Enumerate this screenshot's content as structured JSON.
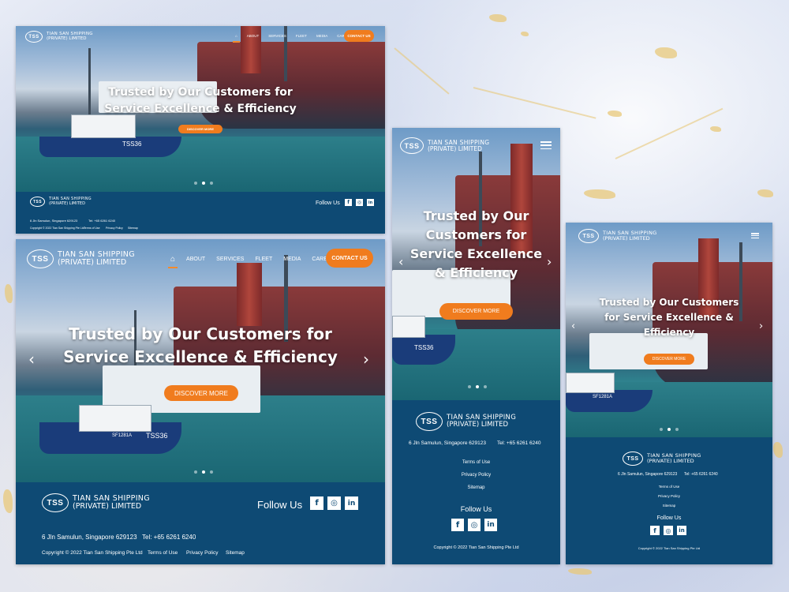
{
  "brand": {
    "initials": "TSS",
    "name_line1": "TIAN SAN SHIPPING",
    "name_line2": "(PRIVATE) LIMITED"
  },
  "nav": {
    "items": [
      "ABOUT",
      "SERVICES",
      "FLEET",
      "MEDIA",
      "CAREER"
    ],
    "contact": "CONTACT US"
  },
  "hero": {
    "headline_line1": "Trusted by Our Customers for",
    "headline_line2": "Service Excellence & Efficiency",
    "headline_tablet": [
      "Trusted by Our Customers",
      "for Service Excellence &",
      "Efficiency"
    ],
    "headline_mobile": [
      "Trusted by Our",
      "Customers for",
      "Service Excellence",
      "& Efficiency"
    ],
    "cta": "DISCOVER MORE",
    "boat_id": "TSS36",
    "boat_reg": "SF1281A"
  },
  "footer": {
    "follow": "Follow Us",
    "address": "6 Jln Samulun, Singapore 629123",
    "tel": "Tel: +65 6261 6240",
    "copyright": "Copyright © 2022 Tian San Shipping Pte Ltd",
    "links": [
      "Terms of Use",
      "Privacy Policy",
      "Sitemap"
    ],
    "social": [
      "facebook-icon",
      "instagram-icon",
      "linkedin-icon"
    ]
  },
  "colors": {
    "brand_blue": "#0e4a74",
    "accent_orange": "#f07c1e"
  }
}
